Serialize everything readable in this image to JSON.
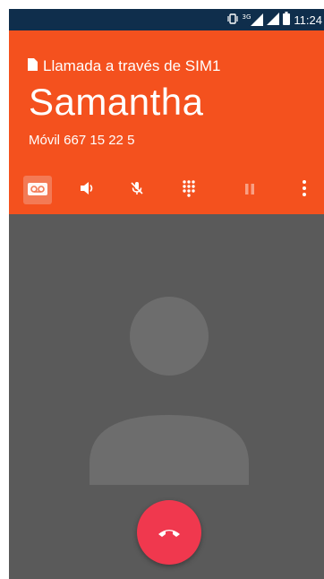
{
  "status_bar": {
    "time": "11:24",
    "network_label": "3G",
    "icons": [
      "vibrate-icon",
      "signal-3g-icon",
      "signal-icon",
      "battery-icon"
    ]
  },
  "call": {
    "sim_label": "Llamada a través de SIM1",
    "contact_name": "Samantha",
    "number_label": "Móvil 667 15 22 5"
  },
  "actions": [
    {
      "name": "voicemail",
      "icon": "voicemail-icon"
    },
    {
      "name": "speaker",
      "icon": "speaker-icon"
    },
    {
      "name": "mute",
      "icon": "mic-off-icon"
    },
    {
      "name": "dialpad",
      "icon": "dialpad-icon"
    },
    {
      "name": "hold",
      "icon": "pause-icon"
    },
    {
      "name": "more",
      "icon": "more-vert-icon"
    }
  ],
  "end_call": {
    "icon": "end-call-icon"
  },
  "colors": {
    "header": "#f4511e",
    "status_bar": "#0f2e4c",
    "body": "#5a5a5a",
    "end_call": "#f0384e"
  }
}
